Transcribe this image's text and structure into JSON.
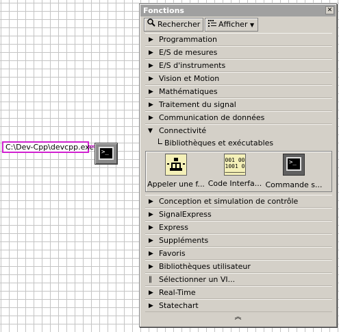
{
  "diagram": {
    "path_constant": "C:\\Dev-Cpp\\devcpp.exe"
  },
  "palette": {
    "title": "Fonctions",
    "toolbar": {
      "search_label": "Rechercher",
      "show_label": "Afficher"
    },
    "categories_before": [
      {
        "label": "Programmation"
      },
      {
        "label": "E/S de mesures"
      },
      {
        "label": "E/S d'instruments"
      },
      {
        "label": "Vision et Motion"
      },
      {
        "label": "Mathématiques"
      },
      {
        "label": "Traitement du signal"
      },
      {
        "label": "Communication de données"
      }
    ],
    "open_category": {
      "label": "Connectivité",
      "subcategory": "Bibliothèques et exécutables",
      "items": [
        {
          "label": "Appeler une f...",
          "icon": "call-library-function-icon"
        },
        {
          "label": "Code Interfa...",
          "icon": "code-interface-node-icon"
        },
        {
          "label": "Commande s...",
          "icon": "system-exec-icon"
        }
      ]
    },
    "categories_after": [
      {
        "label": "Conception et simulation de contrôle"
      },
      {
        "label": "SignalExpress"
      },
      {
        "label": "Express"
      },
      {
        "label": "Suppléments"
      },
      {
        "label": "Favoris"
      },
      {
        "label": "Bibliothèques utilisateur"
      }
    ],
    "select_vi": "Sélectionner un VI...",
    "categories_tail": [
      {
        "label": "Real-Time"
      },
      {
        "label": "Statechart"
      }
    ],
    "more_glyph": "︽"
  }
}
